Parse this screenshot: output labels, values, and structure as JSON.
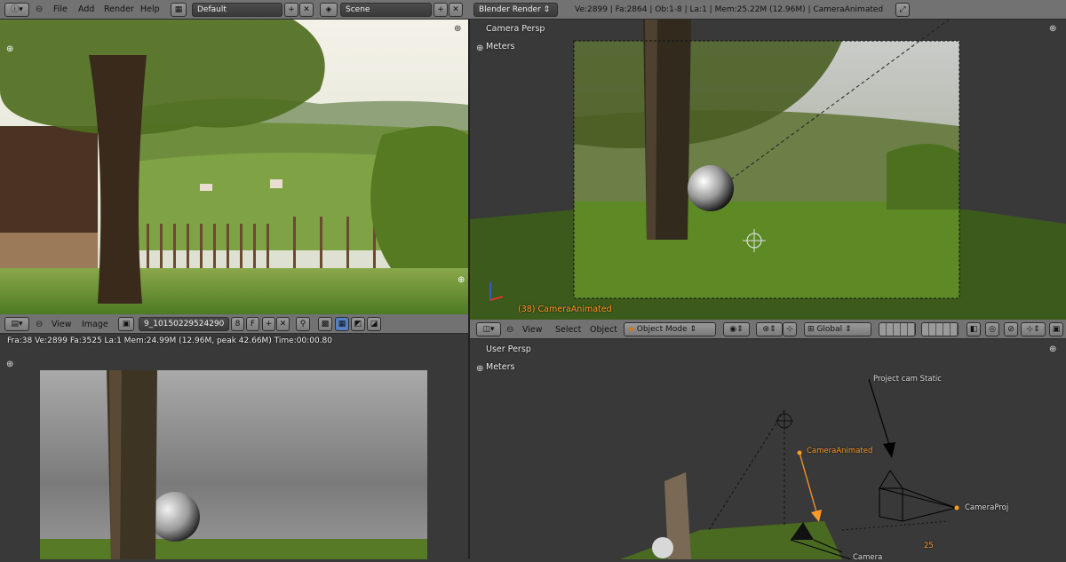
{
  "top_header": {
    "menus": [
      "File",
      "Add",
      "Render",
      "Help"
    ],
    "screen_layout": "Default",
    "scene": "Scene",
    "render_engine": "Blender Render",
    "stats": "Ve:2899 | Fa:2864 | Ob:1-8 | La:1 | Mem:25.22M (12.96M) | CameraAnimated"
  },
  "image_editor_top": {
    "menus": [
      "View",
      "Image"
    ],
    "image_name": "9_10150229524290",
    "user_count": "8",
    "fake_user": "F"
  },
  "image_editor_bottom": {
    "render_info": "Fra:38  Ve:2899 Fa:3525 La:1 Mem:24.99M (12.96M, peak 42.66M) Time:00:00.80"
  },
  "viewport_camera": {
    "view_label": "Camera Persp",
    "units": "Meters",
    "object_label": "(38) CameraAnimated"
  },
  "viewport_header": {
    "menus": [
      "View",
      "Select",
      "Object"
    ],
    "mode": "Object Mode",
    "orientation": "Global"
  },
  "viewport_user": {
    "view_label": "User Persp",
    "units": "Meters",
    "labels": {
      "project_cam": "Project cam Static",
      "camera_animated": "CameraAnimated",
      "camera_proj": "CameraProj",
      "camera": "Camera",
      "frame_number": "25"
    }
  },
  "colors": {
    "header": "#727272",
    "viewport": "#393939",
    "selected": "#ff9a28"
  }
}
